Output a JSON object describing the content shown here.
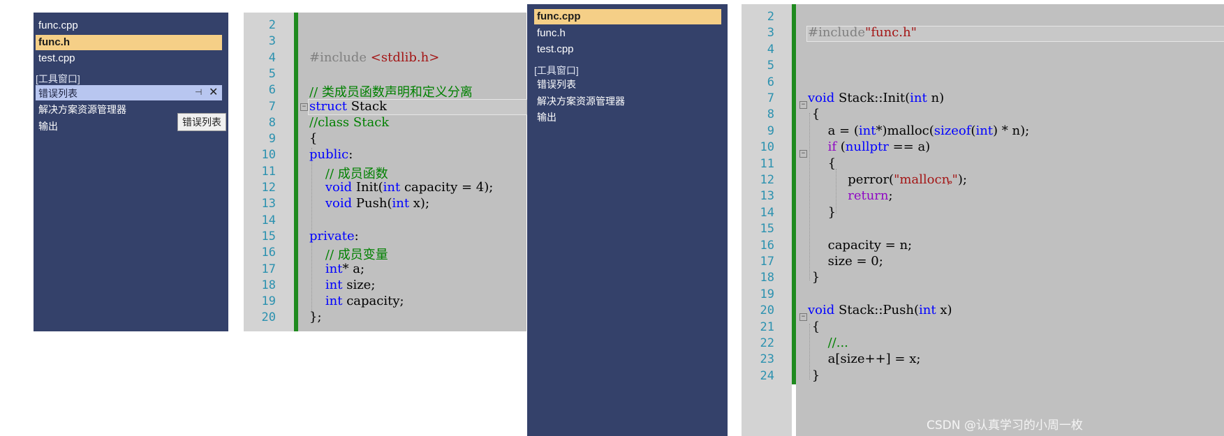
{
  "left_panel": {
    "files": [
      {
        "label": "func.cpp",
        "selected": false
      },
      {
        "label": "func.h",
        "selected": true
      },
      {
        "label": "test.cpp",
        "selected": false
      }
    ],
    "tool_windows_header": "[工具窗口]",
    "tool_items": [
      {
        "label": "错误列表",
        "highlighted": true
      },
      {
        "label": "解决方案资源管理器",
        "highlighted": false
      },
      {
        "label": "输出",
        "highlighted": false
      }
    ],
    "pin_icon": "pin-icon",
    "close_icon": "close-icon",
    "tooltip": "错误列表"
  },
  "left_editor": {
    "lines": [
      {
        "n": "2",
        "code": ""
      },
      {
        "n": "3",
        "code": ""
      },
      {
        "n": "4",
        "html": "<span class='pp'>#include</span> <span class='str'>&lt;stdlib.h&gt;</span>"
      },
      {
        "n": "5",
        "code": ""
      },
      {
        "n": "6",
        "html": "<span class='cmt'>// 类成员函数声明和定义分离</span>"
      },
      {
        "n": "7",
        "html": "<span class='kw'>struct</span> Stack"
      },
      {
        "n": "8",
        "html": "<span class='cmt'>//class Stack</span>"
      },
      {
        "n": "9",
        "code": "{"
      },
      {
        "n": "10",
        "html": "<span class='kw'>public</span>:"
      },
      {
        "n": "11",
        "html": "    <span class='cmt'>// 成员函数</span>"
      },
      {
        "n": "12",
        "html": "    <span class='kw'>void</span> Init(<span class='kw'>int</span> capacity = 4);"
      },
      {
        "n": "13",
        "html": "    <span class='kw'>void</span> Push(<span class='kw'>int</span> x);"
      },
      {
        "n": "14",
        "code": ""
      },
      {
        "n": "15",
        "html": "<span class='kw'>private</span>:"
      },
      {
        "n": "16",
        "html": "    <span class='cmt'>// 成员变量</span>"
      },
      {
        "n": "17",
        "html": "    <span class='kw'>int</span>* a;"
      },
      {
        "n": "18",
        "html": "    <span class='kw'>int</span> size;"
      },
      {
        "n": "19",
        "html": "    <span class='kw'>int</span> capacity;"
      },
      {
        "n": "20",
        "code": "};"
      }
    ]
  },
  "right_panel": {
    "files": [
      {
        "label": "func.cpp",
        "selected": true
      },
      {
        "label": "func.h",
        "selected": false
      },
      {
        "label": "test.cpp",
        "selected": false
      }
    ],
    "tool_windows_header": "[工具窗口]",
    "tool_items": [
      {
        "label": "错误列表"
      },
      {
        "label": "解决方案资源管理器"
      },
      {
        "label": "输出"
      }
    ]
  },
  "right_editor": {
    "lines": [
      {
        "n": "2",
        "code": ""
      },
      {
        "n": "3",
        "html": "<span class='pp'>#include</span><span class='str'>\"func.h\"</span>"
      },
      {
        "n": "4",
        "code": ""
      },
      {
        "n": "5",
        "code": ""
      },
      {
        "n": "6",
        "code": ""
      },
      {
        "n": "7",
        "html": "<span class='kw'>void</span> Stack::Init(<span class='kw'>int</span> n)"
      },
      {
        "n": "8",
        "code": " {"
      },
      {
        "n": "9",
        "html": "     a = (<span class='kw'>int</span>*)malloc(<span class='kw'>sizeof</span>(<span class='kw'>int</span>) * n);"
      },
      {
        "n": "10",
        "html": "     <span class='ctl'>if</span> (<span class='kw'>nullptr</span> == a)"
      },
      {
        "n": "11",
        "code": "     {"
      },
      {
        "n": "12",
        "html": "          perror(<span class='str'>\"mallocȵ\"</span>);"
      },
      {
        "n": "13",
        "html": "          <span class='ctl'>return</span>;"
      },
      {
        "n": "14",
        "code": "     }"
      },
      {
        "n": "15",
        "code": ""
      },
      {
        "n": "16",
        "code": "     capacity = n;"
      },
      {
        "n": "17",
        "code": "     size = 0;"
      },
      {
        "n": "18",
        "code": " }"
      },
      {
        "n": "19",
        "code": ""
      },
      {
        "n": "20",
        "html": "<span class='kw'>void</span> Stack::Push(<span class='kw'>int</span> x)"
      },
      {
        "n": "21",
        "code": " {"
      },
      {
        "n": "22",
        "html": "     <span class='cmt'>//...</span>"
      },
      {
        "n": "23",
        "code": "     a[size++] = x;"
      },
      {
        "n": "24",
        "code": " }"
      }
    ]
  },
  "watermark": "CSDN @认真学习的小周一枚"
}
